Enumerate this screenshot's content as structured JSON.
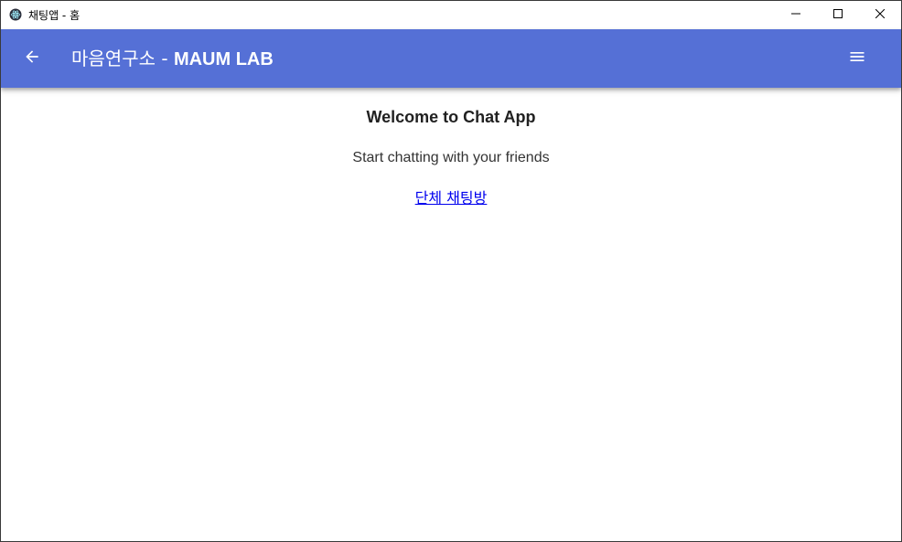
{
  "window": {
    "title": "채팅앱 - 홈",
    "icon": "electron-atom-icon",
    "controls": [
      "minimize-icon",
      "maximize-icon",
      "close-icon"
    ]
  },
  "appbar": {
    "color": "#5570d6",
    "back_icon": "arrow-left-icon",
    "title_korean": "마음연구소",
    "title_separator": " - ",
    "title_brand": "MAUM LAB",
    "menu_icon": "hamburger-menu-icon"
  },
  "main": {
    "heading": "Welcome to Chat App",
    "subtitle": "Start chatting with your friends",
    "group_chat_link": "단체 채팅방"
  }
}
